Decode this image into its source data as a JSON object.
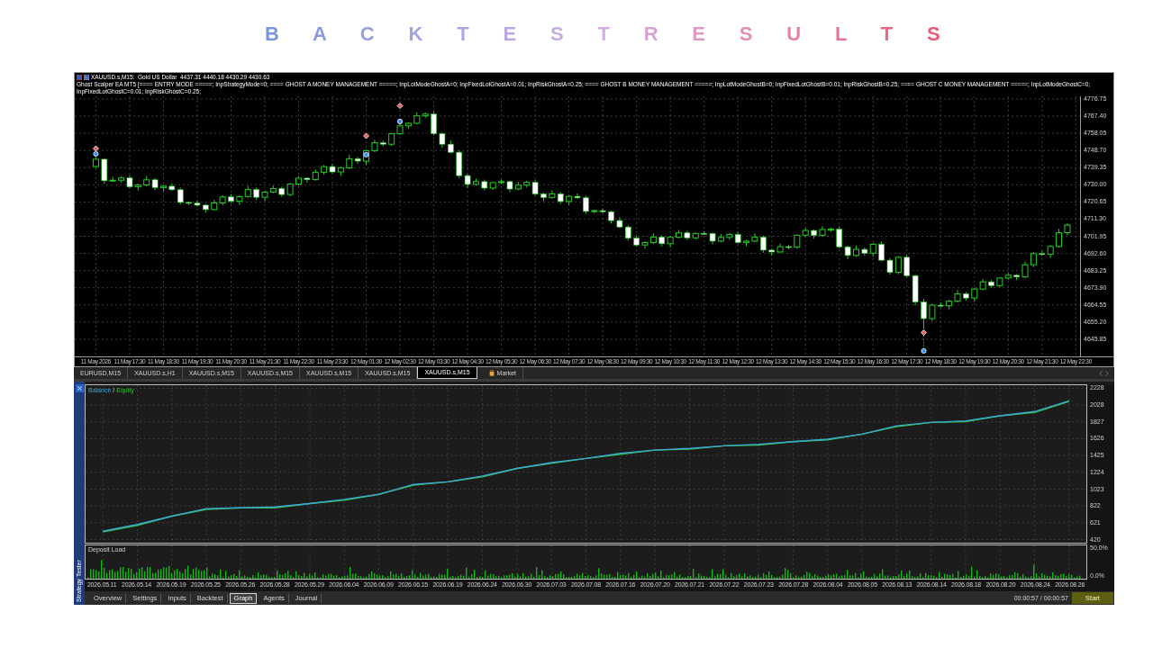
{
  "title": "B A C K T E S T R E S U L T S",
  "price_chart": {
    "symbol_info": "XAUUSD.s,M15:  Gold US Dollar  4437.31 4440.18 4430.29 4430.63",
    "expert_info": "Ghost Scalper EA MT5 [==== ENTRY MODE =====; InpStrategyMode=0; ==== GHOST A MONEY MANAGEMENT =====; InpLotModeGhostA=0; InpFixedLotGhostA=0.01; InpRiskGhostA=0.25; ==== GHOST B MONEY MANAGEMENT =====; InpLotModeGhostB=0; InpFixedLotGhostB=0.01; InpRiskGhostB=0.25; ==== GHOST C MONEY MANAGEMENT =====; InpLotModeGhostC=0; InpFixedLotGhostC=0.01; InpRiskGhostC=0.25;",
    "chart_data": {
      "type": "candlestick",
      "grid": true,
      "ylim": [
        4636.5,
        4778.2
      ],
      "categories": [
        null,
        null,
        "11 May 2026",
        null,
        null,
        null,
        "11 May 17:30",
        null,
        null,
        null,
        "11 May 18:30",
        null,
        null,
        null,
        "11 May 19:30",
        null,
        null,
        null,
        "11 May 20:30",
        null,
        null,
        null,
        "11 May 21:30",
        null,
        null,
        null,
        "11 May 22:30",
        null,
        null,
        null,
        "11 May 23:30",
        null,
        null,
        null,
        "12 May 01:30",
        null,
        null,
        null,
        "12 May 02:30",
        null,
        null,
        null,
        "12 May 03:30",
        null,
        null,
        null,
        "12 May 04:30",
        null,
        null,
        null,
        "12 May 05:30",
        null,
        null,
        null,
        "12 May 06:30",
        null,
        null,
        null,
        "12 May 07:30",
        null,
        null,
        null,
        "12 May 08:30",
        null,
        null,
        null,
        "12 May 09:30",
        null,
        null,
        null,
        "12 May 10:30",
        null,
        null,
        null,
        "12 May 11:30",
        null,
        null,
        null,
        "12 May 12:30",
        null,
        null,
        null,
        "12 May 13:30",
        null,
        null,
        null,
        "12 May 14:30",
        null,
        null,
        null,
        "12 May 15:30",
        null,
        null,
        null,
        "12 May 16:30",
        null,
        null,
        null,
        "12 May 17:30",
        null,
        null,
        null,
        "12 May 18:30",
        null,
        null,
        null,
        "12 May 19:30",
        null,
        null,
        null,
        "12 May 20:30",
        null,
        null,
        null,
        "12 May 21:30",
        null,
        null,
        null,
        "12 May 22:30"
      ],
      "ohlc": [
        null,
        null,
        [
          4740.0,
          4745.1,
          4739.2,
          4743.9
        ],
        [
          4743.9,
          4744.5,
          4730.5,
          4732.2
        ],
        [
          4732.2,
          4734.3,
          4731.6,
          4732.5
        ],
        [
          4732.5,
          4734.6,
          4731.2,
          4733.7
        ],
        [
          4733.7,
          4735.2,
          4728.0,
          4728.9
        ],
        [
          4728.9,
          4730.6,
          4726.9,
          4729.9
        ],
        [
          4729.9,
          4734.8,
          4729.2,
          4732.7
        ],
        [
          4732.7,
          4733.7,
          4727.1,
          4728.5
        ],
        [
          4728.5,
          4730.0,
          4726.6,
          4729.2
        ],
        [
          4729.2,
          4730.8,
          4726.7,
          4727.3
        ],
        [
          4727.3,
          4728.4,
          4719.2,
          4720.4
        ],
        [
          4720.4,
          4720.9,
          4719.0,
          4720.0
        ],
        [
          4720.0,
          4721.2,
          4718.1,
          4718.9
        ],
        [
          4718.9,
          4719.5,
          4714.8,
          4716.5
        ],
        [
          4716.5,
          4721.9,
          4715.9,
          4720.1
        ],
        [
          4720.1,
          4724.3,
          4718.8,
          4723.4
        ],
        [
          4723.4,
          4724.9,
          4720.1,
          4721.0
        ],
        [
          4721.0,
          4724.3,
          4719.0,
          4723.6
        ],
        [
          4723.6,
          4729.5,
          4722.9,
          4727.4
        ],
        [
          4727.4,
          4728.4,
          4721.8,
          4723.2
        ],
        [
          4723.2,
          4726.8,
          4721.3,
          4726.0
        ],
        [
          4726.0,
          4729.5,
          4725.4,
          4727.9
        ],
        [
          4727.9,
          4729.0,
          4723.5,
          4724.7
        ],
        [
          4724.7,
          4730.9,
          4723.7,
          4730.4
        ],
        [
          4730.4,
          4734.8,
          4729.6,
          4733.6
        ],
        [
          4733.6,
          4734.2,
          4731.1,
          4732.8
        ],
        [
          4732.8,
          4738.5,
          4732.2,
          4736.7
        ],
        [
          4736.7,
          4740.8,
          4735.4,
          4739.9
        ],
        [
          4739.9,
          4741.4,
          4736.1,
          4737.0
        ],
        [
          4737.0,
          4739.9,
          4735.0,
          4739.2
        ],
        [
          4739.2,
          4746.3,
          4738.5,
          4744.2
        ],
        [
          4744.2,
          4745.2,
          4741.5,
          4742.9
        ],
        [
          4742.9,
          4749.3,
          4741.0,
          4748.5
        ],
        [
          4748.5,
          4754.5,
          4747.9,
          4752.9
        ],
        [
          4752.9,
          4754.0,
          4750.9,
          4752.1
        ],
        [
          4752.1,
          4758.3,
          4751.1,
          4757.8
        ],
        [
          4757.8,
          4763.3,
          4757.0,
          4762.1
        ],
        [
          4762.1,
          4764.1,
          4760.4,
          4763.5
        ],
        [
          4763.5,
          4769.4,
          4762.9,
          4767.6
        ],
        [
          4767.6,
          4769.4,
          4766.3,
          4768.5
        ],
        [
          4768.5,
          4770.0,
          4756.9,
          4757.8
        ],
        [
          4757.8,
          4758.5,
          4750.1,
          4752.1
        ],
        [
          4752.1,
          4754.2,
          4747.0,
          4747.7
        ],
        [
          4747.7,
          4748.7,
          4733.6,
          4735.0
        ],
        [
          4735.0,
          4735.8,
          4728.3,
          4730.2
        ],
        [
          4730.2,
          4733.3,
          4729.6,
          4731.7
        ],
        [
          4731.7,
          4732.8,
          4727.0,
          4728.2
        ],
        [
          4728.2,
          4731.7,
          4727.2,
          4731.2
        ],
        [
          4731.2,
          4732.9,
          4730.4,
          4731.7
        ],
        [
          4731.7,
          4732.3,
          4726.0,
          4727.7
        ],
        [
          4727.7,
          4731.6,
          4727.1,
          4729.8
        ],
        [
          4729.8,
          4732.2,
          4728.5,
          4731.3
        ],
        [
          4731.3,
          4732.8,
          4724.1,
          4725.0
        ],
        [
          4725.0,
          4725.7,
          4721.1,
          4723.1
        ],
        [
          4723.1,
          4727.1,
          4722.4,
          4725.0
        ],
        [
          4725.0,
          4726.0,
          4719.5,
          4720.9
        ],
        [
          4720.9,
          4724.5,
          4719.0,
          4723.7
        ],
        [
          4723.7,
          4725.3,
          4722.3,
          4722.9
        ],
        [
          4722.9,
          4724.0,
          4714.3,
          4715.5
        ],
        [
          4715.5,
          4716.4,
          4714.5,
          4715.9
        ],
        [
          4715.9,
          4717.1,
          4714.5,
          4715.3
        ],
        [
          4715.3,
          4715.9,
          4708.8,
          4710.5
        ],
        [
          4710.5,
          4712.3,
          4706.4,
          4707.0
        ],
        [
          4707.0,
          4707.9,
          4699.6,
          4700.9
        ],
        [
          4700.9,
          4702.4,
          4696.3,
          4697.2
        ],
        [
          4697.2,
          4699.2,
          4695.2,
          4698.5
        ],
        [
          4698.5,
          4703.6,
          4697.8,
          4701.5
        ],
        [
          4701.5,
          4702.5,
          4696.5,
          4697.9
        ],
        [
          4697.9,
          4702.2,
          4696.0,
          4701.4
        ],
        [
          4701.4,
          4705.4,
          4700.8,
          4703.8
        ],
        [
          4703.8,
          4704.9,
          4699.9,
          4701.1
        ],
        [
          4701.1,
          4704.0,
          4700.1,
          4703.5
        ],
        [
          4703.5,
          4704.7,
          4702.6,
          4703.4
        ],
        [
          4703.4,
          4704.0,
          4697.6,
          4699.3
        ],
        [
          4699.3,
          4703.1,
          4698.7,
          4701.3
        ],
        [
          4701.3,
          4703.8,
          4700.0,
          4702.9
        ],
        [
          4702.9,
          4704.4,
          4697.7,
          4698.6
        ],
        [
          4698.6,
          4700.0,
          4696.6,
          4699.3
        ],
        [
          4699.3,
          4703.5,
          4698.6,
          4701.4
        ],
        [
          4701.4,
          4702.4,
          4693.0,
          4694.4
        ],
        [
          4694.4,
          4695.2,
          4691.5,
          4693.4
        ],
        [
          4693.4,
          4697.9,
          4692.8,
          4696.3
        ],
        [
          4696.3,
          4697.4,
          4694.9,
          4696.1
        ],
        [
          4696.1,
          4703.0,
          4695.1,
          4702.5
        ],
        [
          4702.5,
          4706.3,
          4701.7,
          4705.1
        ],
        [
          4705.1,
          4705.7,
          4700.7,
          4702.4
        ],
        [
          4702.4,
          4707.4,
          4701.8,
          4705.6
        ],
        [
          4705.6,
          4706.7,
          4704.3,
          4705.8
        ],
        [
          4705.8,
          4707.3,
          4695.3,
          4696.2
        ],
        [
          4696.2,
          4696.9,
          4689.5,
          4691.5
        ],
        [
          4691.5,
          4696.9,
          4690.8,
          4694.8
        ],
        [
          4694.8,
          4695.8,
          4691.3,
          4692.7
        ],
        [
          4692.7,
          4698.4,
          4690.8,
          4697.6
        ],
        [
          4697.6,
          4699.2,
          4688.3,
          4688.9
        ],
        [
          4688.9,
          4690.0,
          4681.1,
          4682.3
        ],
        [
          4682.3,
          4691.0,
          4681.3,
          4690.5
        ],
        [
          4690.5,
          4691.7,
          4679.7,
          4680.5
        ],
        [
          4680.5,
          4681.1,
          4664.4,
          4666.1
        ],
        [
          4666.1,
          4667.9,
          4651.5,
          4657.1
        ],
        [
          4657.1,
          4665.3,
          4655.8,
          4664.4
        ],
        [
          4664.4,
          4665.9,
          4663.2,
          4664.1
        ],
        [
          4664.1,
          4667.3,
          4662.1,
          4666.6
        ],
        [
          4666.6,
          4672.7,
          4665.9,
          4670.6
        ],
        [
          4670.6,
          4671.6,
          4666.9,
          4668.3
        ],
        [
          4668.3,
          4674.0,
          4666.4,
          4673.2
        ],
        [
          4673.2,
          4678.7,
          4672.6,
          4677.1
        ],
        [
          4677.1,
          4678.2,
          4673.9,
          4675.1
        ],
        [
          4675.1,
          4679.7,
          4674.1,
          4679.2
        ],
        [
          4679.2,
          4681.9,
          4678.4,
          4680.7
        ],
        [
          4680.7,
          4681.3,
          4678.1,
          4679.8
        ],
        [
          4679.8,
          4688.2,
          4679.2,
          4686.4
        ],
        [
          4686.4,
          4693.4,
          4685.1,
          4692.5
        ],
        [
          4692.5,
          4694.0,
          4691.3,
          4692.2
        ],
        [
          4692.2,
          4697.1,
          4690.2,
          4696.4
        ],
        [
          4696.4,
          4706.0,
          4695.7,
          4703.9
        ],
        [
          4703.9,
          4709.0,
          4702.5,
          4708.0
        ],
        null
      ],
      "yticks": [
        {
          "value": 4776.75,
          "label": "4776.75"
        },
        {
          "value": 4767.4,
          "label": "4767.40"
        },
        {
          "value": 4758.05,
          "label": "4758.05"
        },
        {
          "value": 4748.7,
          "label": "4748.70"
        },
        {
          "value": 4739.35,
          "label": "4739.35"
        },
        {
          "value": 4730,
          "label": "4730.00"
        },
        {
          "value": 4720.65,
          "label": "4720.65"
        },
        {
          "value": 4711.3,
          "label": "4711.30"
        },
        {
          "value": 4701.95,
          "label": "4701.95"
        },
        {
          "value": 4692.6,
          "label": "4692.60"
        },
        {
          "value": 4683.25,
          "label": "4683.25"
        },
        {
          "value": 4673.9,
          "label": "4673.90"
        },
        {
          "value": 4664.55,
          "label": "4664.55"
        },
        {
          "value": 4655.2,
          "label": "4655.20"
        },
        {
          "value": 4645.85,
          "label": "4645.85"
        }
      ]
    }
  },
  "chart_tabs": [
    {
      "label": "EURUSD,M15",
      "selected": false,
      "kind": "chart"
    },
    {
      "label": "XAUUSD.s,H1",
      "selected": false,
      "kind": "chart"
    },
    {
      "label": "XAUUSD.s,M15",
      "selected": false,
      "kind": "chart"
    },
    {
      "label": "XAUUSD.s,M15",
      "selected": false,
      "kind": "chart"
    },
    {
      "label": "XAUUSD.s,M15",
      "selected": false,
      "kind": "chart"
    },
    {
      "label": "XAUUSD.s,M15",
      "selected": false,
      "kind": "chart"
    },
    {
      "label": "XAUUSD.s,M15",
      "selected": true,
      "kind": "chart"
    },
    {
      "label": "Market",
      "selected": false,
      "kind": "market"
    }
  ],
  "tester": {
    "side_label": "Strategy Tester",
    "graph": {
      "legend_separator": "/",
      "chart_data": {
        "type": "line",
        "grid": true,
        "categories": [
          "2026.05.11",
          "2026.05.14",
          "2026.05.19",
          "2026.05.25",
          "2026.05.26",
          "2026.05.28",
          "2026.05.29",
          "2026.06.04",
          "2026.06.09",
          "2026.06.15",
          "2026.06.19",
          "2026.06.24",
          "2026.06.30",
          "2026.07.03",
          "2026.07.08",
          "2026.07.16",
          "2026.07.20",
          "2026.07.21",
          "2026.07.22",
          "2026.07.23",
          "2026.07.28",
          "2026.08.04",
          "2026.08.05",
          "2026.08.13",
          "2026.08.14",
          "2026.08.18",
          "2026.08.20",
          "2026.08.24",
          "2026.08.26"
        ],
        "series": [
          {
            "name": "Balance",
            "color": "#3aa8d8",
            "values": [
              520,
              600,
              700,
              790,
              800,
              810,
              850,
              900,
              960,
              1080,
              1110,
              1180,
              1270,
              1340,
              1390,
              1450,
              1490,
              1510,
              1540,
              1560,
              1590,
              1620,
              1680,
              1780,
              1820,
              1840,
              1900,
              1950,
              2080
            ]
          },
          {
            "name": "Equity",
            "color": "#33c233",
            "values": [
              510,
              590,
              700,
              780,
              800,
              800,
              850,
              890,
              960,
              1070,
              1110,
              1170,
              1270,
              1330,
              1390,
              1440,
              1490,
              1500,
              1540,
              1550,
              1590,
              1610,
              1680,
              1770,
              1820,
              1830,
              1900,
              1940,
              2070
            ]
          }
        ],
        "ylim": [
          420,
          2228
        ],
        "yticks": [
          2228,
          2028,
          1827,
          1626,
          1425,
          1224,
          1023,
          822,
          621,
          420
        ]
      }
    },
    "deposit_load": {
      "label": "Deposit Load",
      "axis": [
        "50.0%",
        "0.0%"
      ]
    },
    "tabs": [
      {
        "label": "Overview",
        "selected": false
      },
      {
        "label": "Settings",
        "selected": false
      },
      {
        "label": "Inputs",
        "selected": false
      },
      {
        "label": "Backtest",
        "selected": false
      },
      {
        "label": "Graph",
        "selected": true
      },
      {
        "label": "Agents",
        "selected": false
      },
      {
        "label": "Journal",
        "selected": false
      }
    ],
    "elapsed": "00:00:57 / 00:00:57",
    "start_button": "Start"
  }
}
